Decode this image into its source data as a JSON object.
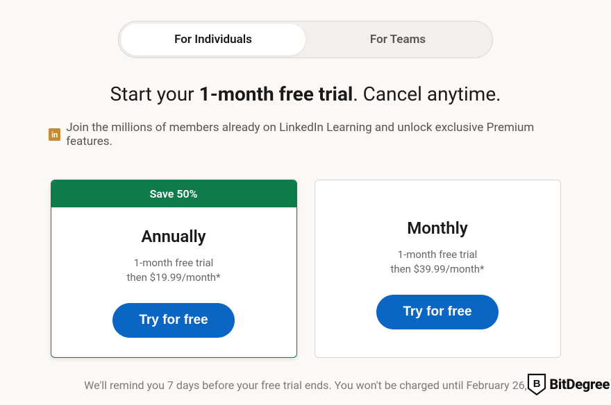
{
  "tabs": {
    "individuals": "For Individuals",
    "teams": "For Teams"
  },
  "headline": {
    "prefix": "Start your ",
    "bold": "1-month free trial",
    "suffix": ". Cancel anytime."
  },
  "subtext": {
    "badge": "in",
    "text": "Join the millions of members already on LinkedIn Learning and unlock exclusive Premium features."
  },
  "plans": {
    "annual": {
      "save_banner": "Save 50%",
      "title": "Annually",
      "trial": "1-month free trial",
      "price": "then $19.99/month*",
      "cta": "Try for free"
    },
    "monthly": {
      "title": "Monthly",
      "trial": "1-month free trial",
      "price": "then $39.99/month*",
      "cta": "Try for free"
    }
  },
  "footer_note": "We'll remind you 7 days before your free trial ends. You won't be charged until February 26,",
  "watermark": "BitDegree"
}
